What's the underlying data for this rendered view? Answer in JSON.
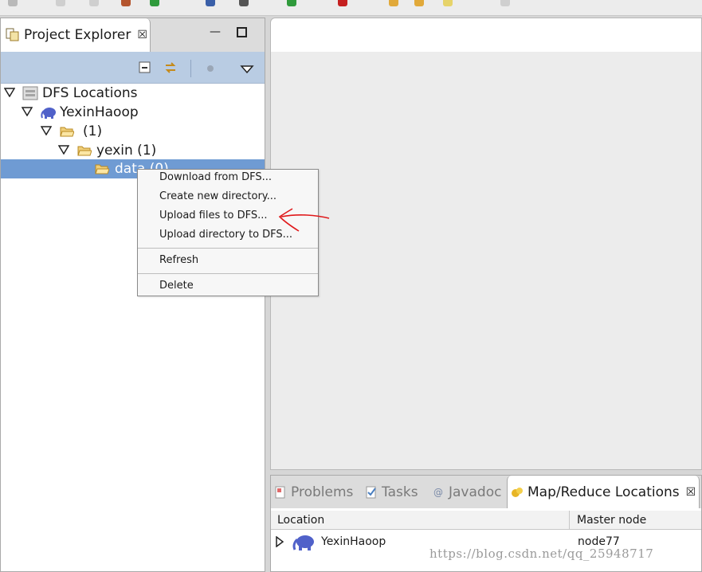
{
  "project_explorer": {
    "tab_title": "Project Explorer",
    "tree": [
      {
        "label": "DFS Locations",
        "icon": "server-stack-icon"
      },
      {
        "label": "YexinHaoop",
        "icon": "elephant-icon"
      },
      {
        "label": "(1)",
        "icon": "folder-open-icon"
      },
      {
        "label": "yexin (1)",
        "icon": "folder-open-icon"
      },
      {
        "label": "data (0)",
        "icon": "folder-open-icon"
      }
    ]
  },
  "context_menu": {
    "items": [
      "Download from DFS...",
      "Create new directory...",
      "Upload files to DFS...",
      "Upload directory to DFS...",
      "Refresh",
      "Delete"
    ]
  },
  "bottom_panel": {
    "tabs": [
      {
        "label": "Problems",
        "active": false
      },
      {
        "label": "Tasks",
        "active": false
      },
      {
        "label": "Javadoc",
        "active": false
      },
      {
        "label": "Map/Reduce Locations",
        "active": true
      }
    ],
    "columns": [
      "Location",
      "Master node"
    ],
    "rows": [
      {
        "location": "YexinHaoop",
        "master": "node77"
      }
    ]
  },
  "watermark": "https://blog.csdn.net/qq_25948717",
  "colors": {
    "selection": "#6f9bd3",
    "toolbar_blue": "#b9cce3",
    "annotation_arrow": "#e0191b"
  }
}
